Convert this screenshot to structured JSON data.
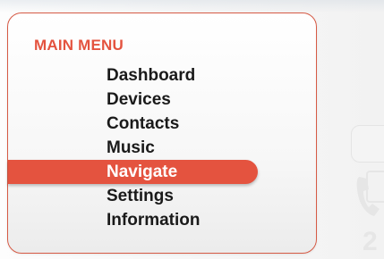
{
  "menu": {
    "title": "MAIN MENU",
    "selected_index": 4,
    "items": [
      {
        "label": "Dashboard"
      },
      {
        "label": "Devices"
      },
      {
        "label": "Contacts"
      },
      {
        "label": "Music"
      },
      {
        "label": "Navigate"
      },
      {
        "label": "Settings"
      },
      {
        "label": "Information"
      }
    ]
  },
  "background": {
    "partial_number": "2"
  },
  "colors": {
    "accent": "#e4533f",
    "border": "#d65a45",
    "text": "#1a1a1a",
    "selected_text": "#ffffff"
  },
  "icons": {
    "background_device": "phone-icon"
  }
}
